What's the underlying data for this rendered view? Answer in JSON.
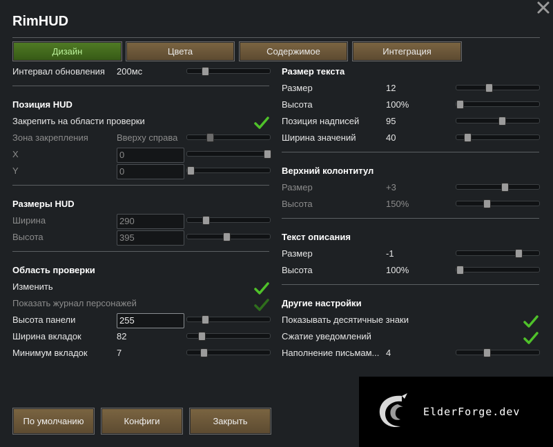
{
  "window": {
    "title": "RimHUD"
  },
  "tabs": [
    {
      "label": "Дизайн",
      "active": true
    },
    {
      "label": "Цвета",
      "active": false
    },
    {
      "label": "Содержимое",
      "active": false
    },
    {
      "label": "Интеграция",
      "active": false
    }
  ],
  "left": {
    "refresh": {
      "label": "Интервал обновления",
      "value": "200мс",
      "slider": 0.19
    },
    "hud_position": {
      "heading": "Позиция HUD",
      "dock_label": "Закрепить на области проверки",
      "dock_checked": true,
      "anchor_label": "Зона закрепления",
      "anchor_value": "Вверху справа",
      "anchor_slider": 0.25,
      "x_label": "X",
      "x_value": "0",
      "x_slider": 1.0,
      "y_label": "Y",
      "y_value": "0",
      "y_slider": 0.0
    },
    "hud_size": {
      "heading": "Размеры HUD",
      "width_label": "Ширина",
      "width_value": "290",
      "width_slider": 0.2,
      "height_label": "Высота",
      "height_value": "395",
      "height_slider": 0.47
    },
    "inspect": {
      "heading": "Область проверки",
      "change_label": "Изменить",
      "change_checked": true,
      "show_log_label": "Показать журнал персонажей",
      "show_log_checked": true,
      "panel_height_label": "Высота панели",
      "panel_height_value": "255",
      "panel_height_slider": 0.19,
      "tab_width_label": "Ширина вкладок",
      "tab_width_value": "82",
      "tab_width_slider": 0.14,
      "min_tabs_label": "Минимум вкладок",
      "min_tabs_value": "7",
      "min_tabs_slider": 0.17
    }
  },
  "right": {
    "text_size": {
      "heading": "Размер текста",
      "rows": [
        {
          "label": "Размер",
          "value": "12",
          "slider": 0.38,
          "dim": false
        },
        {
          "label": "Высота",
          "value": "100%",
          "slider": 0.0,
          "dim": false
        },
        {
          "label": "Позиция надписей",
          "value": "95",
          "slider": 0.55,
          "dim": false
        },
        {
          "label": "Ширина значений",
          "value": "40",
          "slider": 0.1,
          "dim": false
        }
      ]
    },
    "header": {
      "heading": "Верхний колонтитул",
      "rows": [
        {
          "label": "Размер",
          "value": "+3",
          "slider": 0.59,
          "dim": true
        },
        {
          "label": "Высота",
          "value": "150%",
          "slider": 0.35,
          "dim": true
        }
      ]
    },
    "description": {
      "heading": "Текст описания",
      "rows": [
        {
          "label": "Размер",
          "value": "-1",
          "slider": 0.77,
          "dim": false
        },
        {
          "label": "Высота",
          "value": "100%",
          "slider": 0.0,
          "dim": false
        }
      ]
    },
    "other": {
      "heading": "Другие настройки",
      "decimals_label": "Показывать десятичные знаки",
      "decimals_checked": true,
      "compress_label": "Сжатие уведомлений",
      "compress_checked": true,
      "letter_fill_label": "Наполнение письмам...",
      "letter_fill_value": "4",
      "letter_fill_slider": 0.35
    }
  },
  "buttons": {
    "defaults": "По умолчанию",
    "configs": "Конфиги",
    "close": "Закрыть"
  },
  "watermark": {
    "text": "ElderForge.dev"
  },
  "colors": {
    "check": "#4fc12a",
    "tab_active": "#4f7a24",
    "tab": "#7a6441"
  }
}
